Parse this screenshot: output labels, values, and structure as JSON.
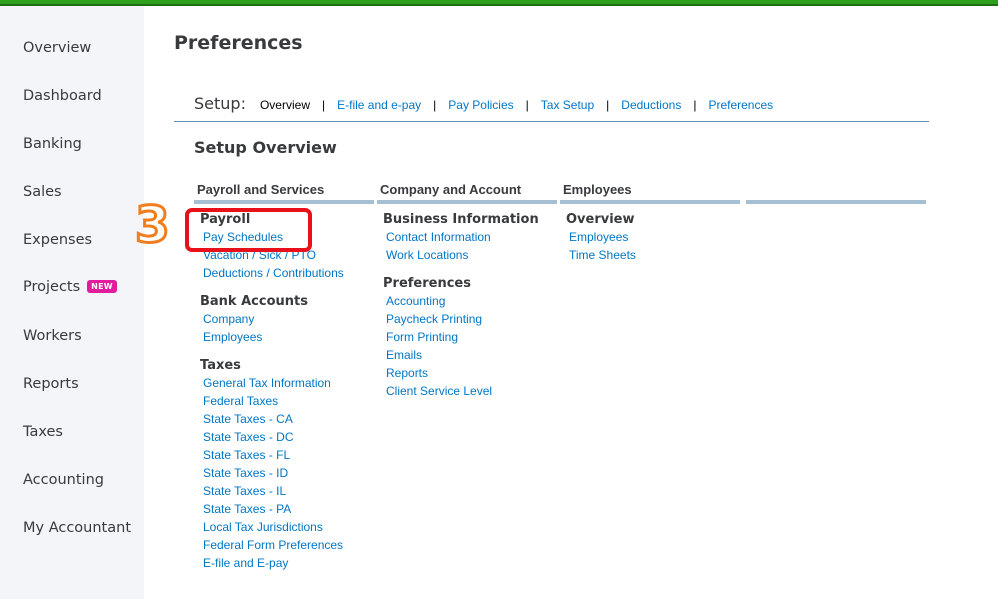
{
  "sidebar": {
    "items": [
      {
        "label": "Overview"
      },
      {
        "label": "Dashboard"
      },
      {
        "label": "Banking"
      },
      {
        "label": "Sales"
      },
      {
        "label": "Expenses"
      },
      {
        "label": "Projects",
        "badge": "NEW"
      },
      {
        "label": "Workers"
      },
      {
        "label": "Reports"
      },
      {
        "label": "Taxes"
      },
      {
        "label": "Accounting"
      },
      {
        "label": "My Accountant"
      }
    ]
  },
  "page_title": "Preferences",
  "setup": {
    "label": "Setup:",
    "current": "Overview",
    "separator": "|",
    "links": [
      "E-file and e-pay",
      "Pay Policies",
      "Tax Setup",
      "Deductions",
      "Preferences"
    ]
  },
  "section_title": "Setup Overview",
  "columns": [
    {
      "header": "Payroll and Services",
      "groups": [
        {
          "title": "Payroll",
          "links": [
            "Pay Schedules",
            "Vacation / Sick / PTO",
            "Deductions / Contributions"
          ]
        },
        {
          "title": "Bank Accounts",
          "links": [
            "Company",
            "Employees"
          ]
        },
        {
          "title": "Taxes",
          "links": [
            "General Tax Information",
            "Federal Taxes",
            "State Taxes - CA",
            "State Taxes - DC",
            "State Taxes - FL",
            "State Taxes - ID",
            "State Taxes - IL",
            "State Taxes - PA",
            "Local Tax Jurisdictions",
            "Federal Form Preferences",
            "E-file and E-pay"
          ]
        }
      ]
    },
    {
      "header": "Company and Account",
      "groups": [
        {
          "title": "Business Information",
          "links": [
            "Contact Information",
            "Work Locations"
          ]
        },
        {
          "title": "Preferences",
          "links": [
            "Accounting",
            "Paycheck Printing",
            "Form Printing",
            "Emails",
            "Reports",
            "Client Service Level"
          ]
        }
      ]
    },
    {
      "header": "Employees",
      "groups": [
        {
          "title": "Overview",
          "links": [
            "Employees",
            "Time Sheets"
          ]
        }
      ]
    }
  ],
  "annotation": {
    "step": "3",
    "highlight_color": "#e8101a",
    "step_color": "#f07d1e"
  },
  "colors": {
    "brand_green": "#2ca01c",
    "link_blue": "#0077c5",
    "sidebar_bg": "#f4f5f8",
    "badge_pink": "#e31c9e"
  }
}
